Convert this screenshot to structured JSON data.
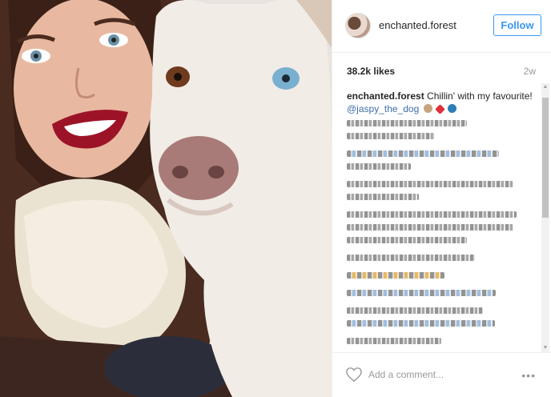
{
  "post": {
    "username": "enchanted.forest",
    "follow_label": "Follow",
    "likes": "38.2k likes",
    "time_ago": "2w",
    "caption_user": "enchanted.forest",
    "caption_text": "Chillin' with my favourite!",
    "caption_mention": "@jaspy_the_dog",
    "comment_placeholder": "Add a comment...",
    "more_label": "•••"
  },
  "colors": {
    "accent": "#3897f0",
    "text": "#262626",
    "muted": "#999999"
  }
}
